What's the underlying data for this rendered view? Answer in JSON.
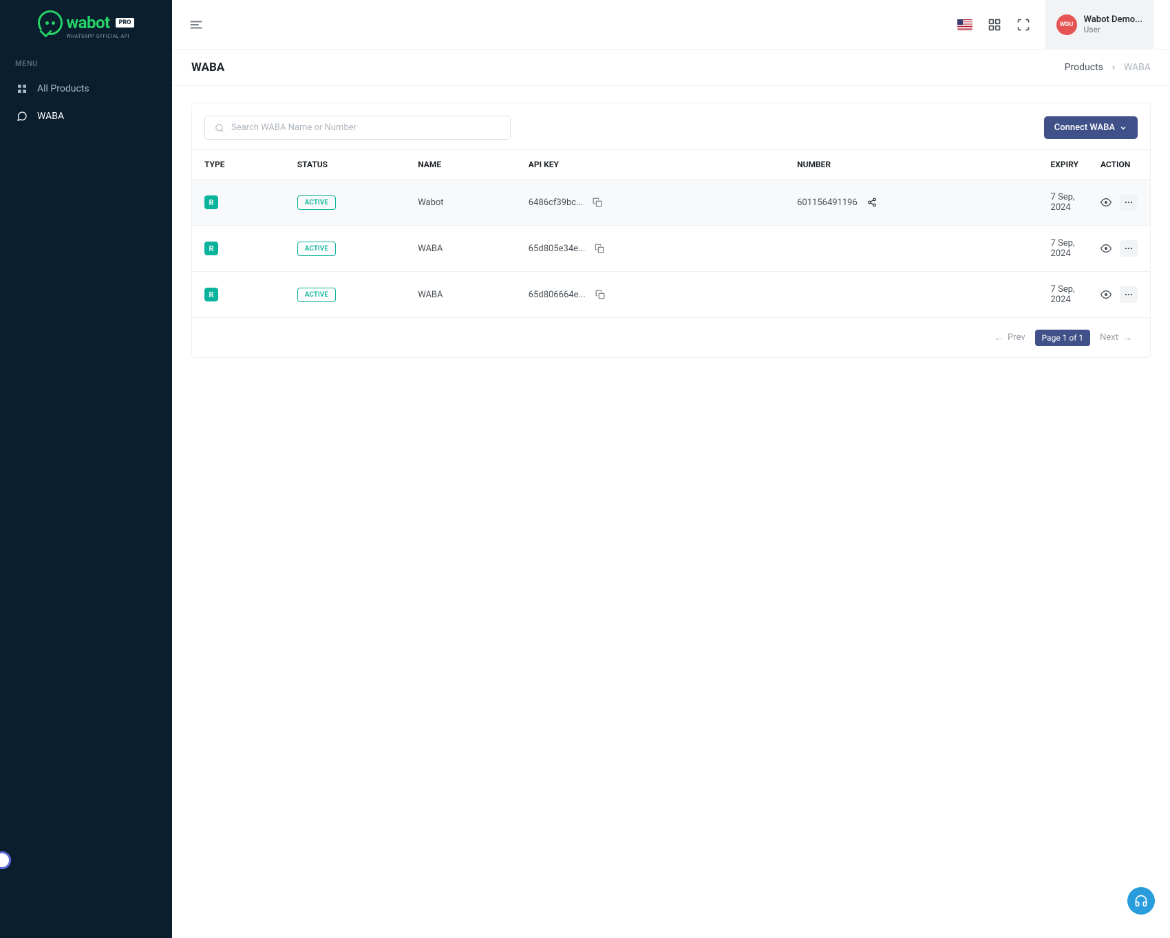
{
  "brand": {
    "name": "wabot",
    "pro": "PRO",
    "sub": "WHATSAPP OFFICIAL API"
  },
  "sidebar": {
    "menu_label": "MENU",
    "items": [
      {
        "label": "All Products"
      },
      {
        "label": "WABA"
      }
    ]
  },
  "header": {
    "user_initials": "WDU",
    "user_name": "Wabot Demo...",
    "user_role": "User"
  },
  "page": {
    "title": "WABA",
    "breadcrumb_root": "Products",
    "breadcrumb_current": "WABA"
  },
  "toolbar": {
    "search_placeholder": "Search WABA Name or Number",
    "connect_label": "Connect WABA"
  },
  "table": {
    "columns": {
      "type": "TYPE",
      "status": "STATUS",
      "name": "NAME",
      "apikey": "API KEY",
      "number": "NUMBER",
      "expiry": "EXPIRY",
      "action": "ACTION"
    },
    "rows": [
      {
        "type": "R",
        "status": "ACTIVE",
        "name": "Wabot",
        "apikey": "6486cf39bc...",
        "number": "601156491196",
        "expiry": "7 Sep, 2024",
        "show_share": true
      },
      {
        "type": "R",
        "status": "ACTIVE",
        "name": "WABA",
        "apikey": "65d805e34e...",
        "number": "",
        "expiry": "7 Sep, 2024",
        "show_share": false
      },
      {
        "type": "R",
        "status": "ACTIVE",
        "name": "WABA",
        "apikey": "65d806664e...",
        "number": "",
        "expiry": "7 Sep, 2024",
        "show_share": false
      }
    ]
  },
  "pagination": {
    "prev": "Prev",
    "current": "Page 1 of 1",
    "next": "Next"
  }
}
